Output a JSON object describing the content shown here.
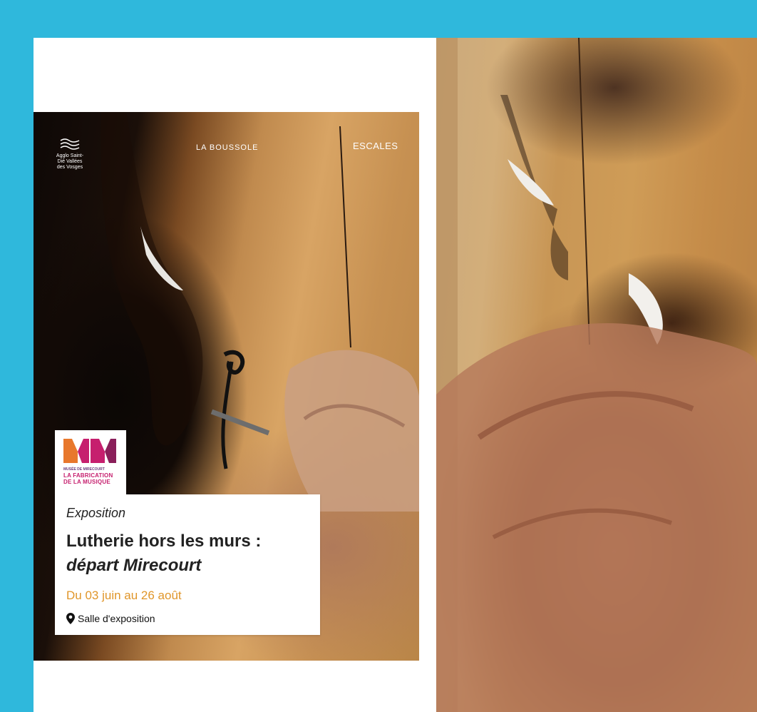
{
  "poster": {
    "logos": {
      "agglo": "Agglo Saint-Dié Vallées des Vosges",
      "boussole": "LA BOUSSOLE",
      "escales": "ESCALES",
      "museum": {
        "letters": "MM",
        "line1": "MUSÉE DE MIRECOURT",
        "line2": "LA FABRICATION",
        "line3": "DE LA MUSIQUE"
      }
    },
    "event": {
      "kind": "Exposition",
      "title_line1": "Lutherie hors les murs :",
      "title_line2": "départ Mirecourt",
      "dates": "Du 03 juin au 26 août",
      "location": "Salle d'exposition"
    }
  },
  "colors": {
    "page_background": "#2fb8dc",
    "date_accent": "#e0962a",
    "museum_magenta": "#c61f6e",
    "museum_orange": "#e8782c"
  },
  "icons": {
    "location": "map-pin-icon"
  }
}
